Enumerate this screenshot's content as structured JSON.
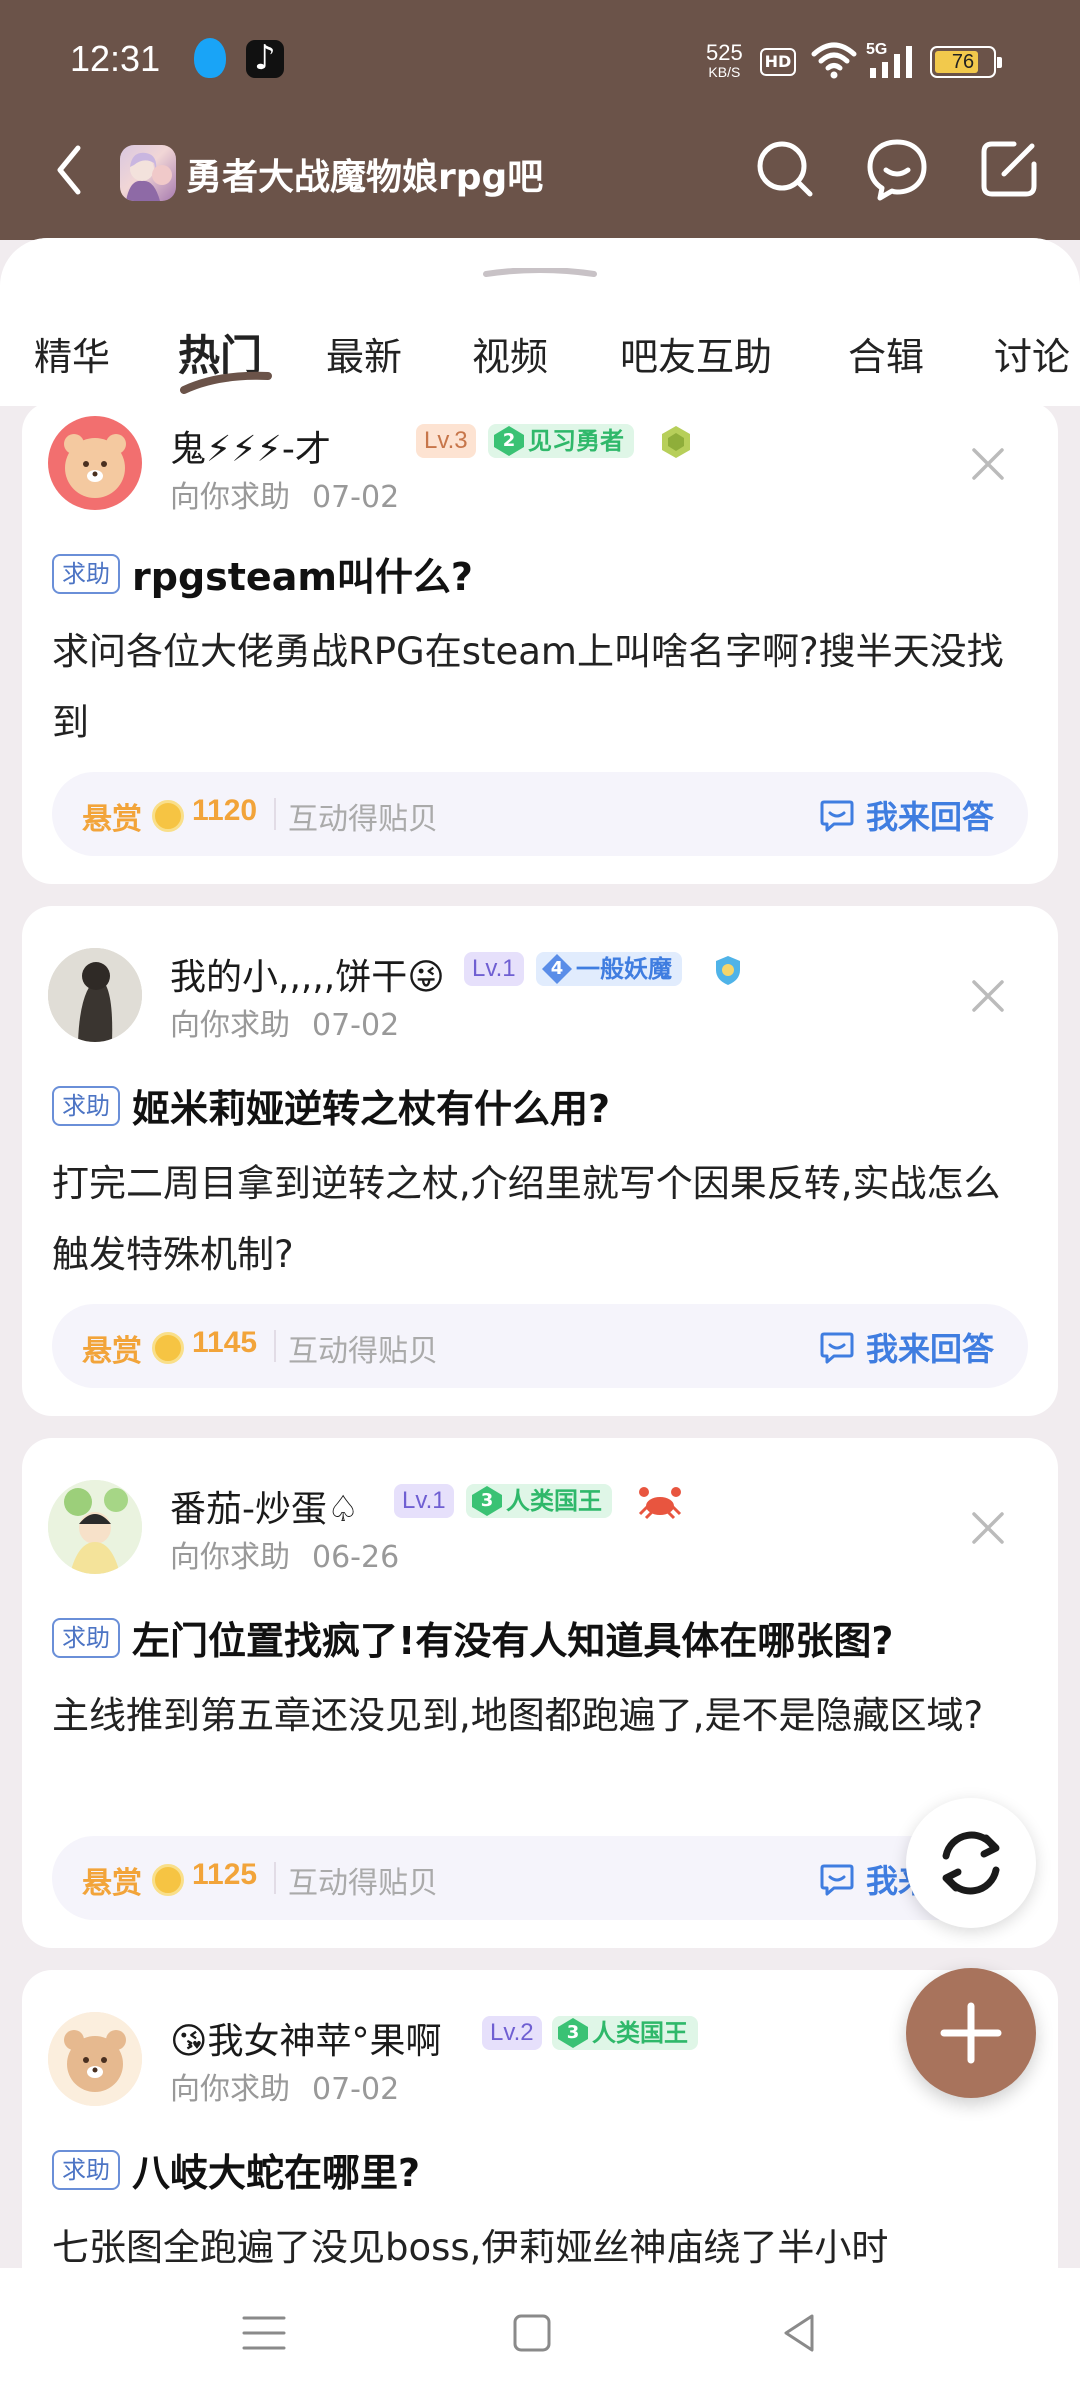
{
  "status_bar": {
    "time": "12:31",
    "net_speed_value": "525",
    "net_speed_unit": "KB/S",
    "hd_label": "HD",
    "signal_label": "5G",
    "battery": "76",
    "battery_level": 0.76
  },
  "header": {
    "forum_name": "勇者大战魔物娘rpg吧",
    "icons": [
      "back-icon",
      "search-icon",
      "message-icon",
      "edit-icon"
    ]
  },
  "tabs": [
    {
      "label": "精华"
    },
    {
      "label": "热门"
    },
    {
      "label": "最新"
    },
    {
      "label": "视频"
    },
    {
      "label": "吧友互助"
    },
    {
      "label": "合辑"
    },
    {
      "label": "讨论"
    }
  ],
  "active_tab": "热门",
  "posts": [
    {
      "username": "鬼⚡⚡⚡-才",
      "level": "Lv.3",
      "badge_num": "2",
      "badge_label": "见习勇者",
      "category": "向你求助",
      "date": "07-02",
      "tag": "求助",
      "title": "rpgsteam叫什么?",
      "body": "求问各位大佬勇战RPG在steam上叫啥名字啊?搜半天没找到",
      "reward_label": "悬赏",
      "reward_amount": "1120",
      "reward_note": "互动得贴贝",
      "answer_label": "我来回答"
    },
    {
      "username": "我的小,,,,,饼干😜",
      "level": "Lv.1",
      "badge_num": "4",
      "badge_label": "一般妖魔",
      "category": "向你求助",
      "date": "07-02",
      "tag": "求助",
      "title": "姬米莉娅逆转之杖有什么用?",
      "body": "打完二周目拿到逆转之杖,介绍里就写个因果反转,实战怎么触发特殊机制?",
      "reward_label": "悬赏",
      "reward_amount": "1145",
      "reward_note": "互动得贴贝",
      "answer_label": "我来回答"
    },
    {
      "username": "番茄-炒蛋♤",
      "level": "Lv.1",
      "badge_num": "3",
      "badge_label": "人类国王",
      "category": "向你求助",
      "date": "06-26",
      "tag": "求助",
      "title": "左门位置找疯了!有没有人知道具体在哪张图?",
      "body": "主线推到第五章还没见到,地图都跑遍了,是不是隐藏区域?",
      "reward_label": "悬赏",
      "reward_amount": "1125",
      "reward_note": "互动得贴贝",
      "answer_label": "我来回答"
    },
    {
      "username": "😘我女神苹°果啊",
      "level": "Lv.2",
      "badge_num": "3",
      "badge_label": "人类国王",
      "category": "向你求助",
      "date": "07-02",
      "tag": "求助",
      "title": "八岐大蛇在哪里?",
      "body": "七张图全跑遍了没见boss,伊莉娅丝神庙绕了半小时"
    }
  ],
  "colors": {
    "header_bg": "#6b5349",
    "accent_blue": "#3f7de0",
    "reward_orange": "#f2a43a",
    "fab_brown": "#a8735c"
  }
}
